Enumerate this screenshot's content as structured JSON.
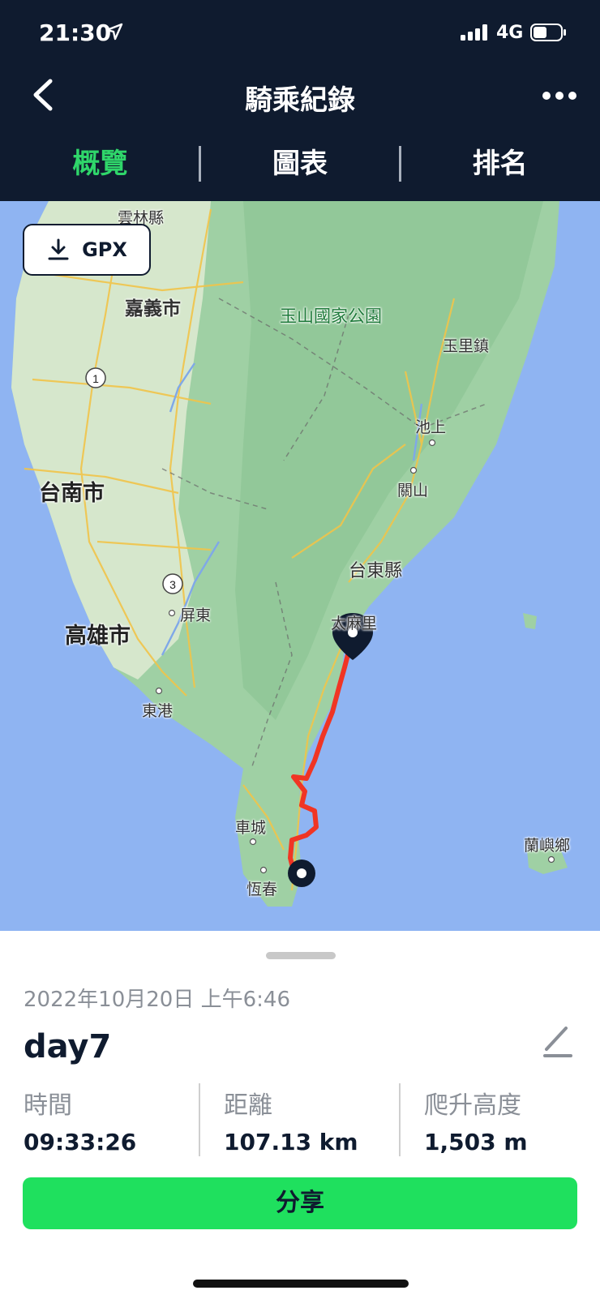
{
  "status_bar": {
    "time": "21:30",
    "network": "4G"
  },
  "header": {
    "title": "騎乘紀錄"
  },
  "tabs": [
    {
      "label": "概覽",
      "active": true
    },
    {
      "label": "圖表",
      "active": false
    },
    {
      "label": "排名",
      "active": false
    }
  ],
  "map": {
    "gpx_button_label": "GPX",
    "labels": {
      "yunlin": "雲林縣",
      "chiayi": "嘉義市",
      "yushan": "玉山國家公園",
      "yuli": "玉里鎮",
      "chishang": "池上",
      "guanshan": "關山",
      "tainan": "台南市",
      "taitung": "台東縣",
      "pingtung": "屏東",
      "kaohsiung": "高雄市",
      "taimali": "太麻里",
      "donggang": "東港",
      "checheng": "車城",
      "lanyu": "蘭嶼鄉",
      "hengchun": "恆春"
    },
    "highway_markers": [
      "1",
      "3"
    ],
    "route_color": "#f03524"
  },
  "activity": {
    "date": "2022年10月20日 上午6:46",
    "name": "day7",
    "stats": [
      {
        "label": "時間",
        "value": "09:33:26"
      },
      {
        "label": "距離",
        "value": "107.13 km"
      },
      {
        "label": "爬升高度",
        "value": "1,503 m"
      }
    ],
    "share_label": "分享"
  },
  "colors": {
    "header_bg": "#0f1b2f",
    "active_tab": "#2fd66a",
    "share_button": "#1fe05e"
  }
}
